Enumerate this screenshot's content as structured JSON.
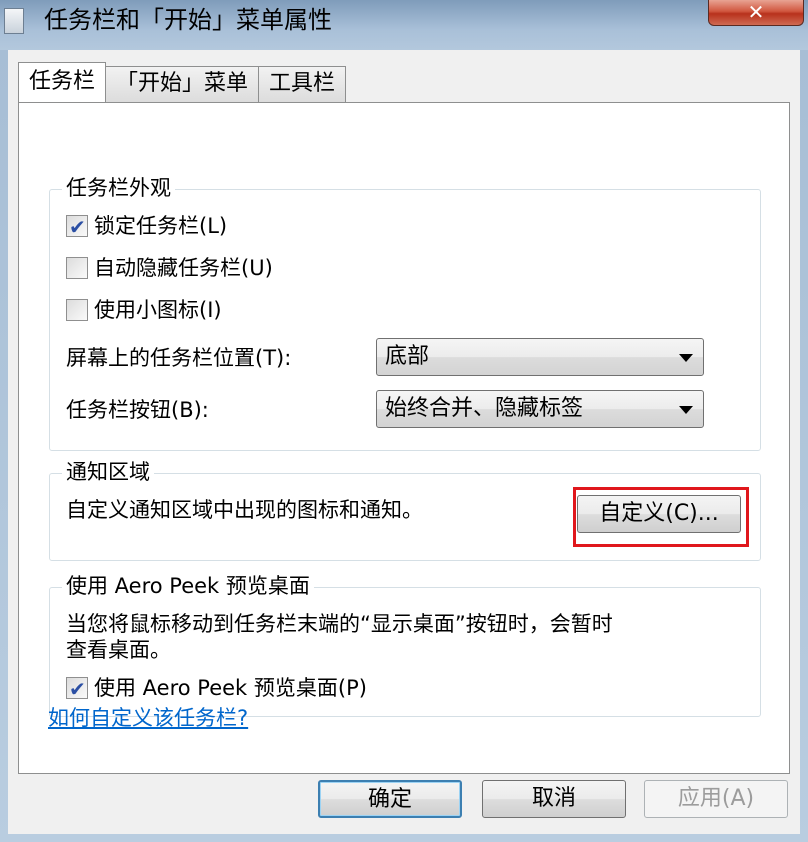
{
  "window": {
    "title": "任务栏和「开始」菜单属性",
    "close_label": "✕"
  },
  "tabs": [
    {
      "label": "任务栏",
      "active": true
    },
    {
      "label": "「开始」菜单",
      "active": false
    },
    {
      "label": "工具栏",
      "active": false
    }
  ],
  "appearance": {
    "title": "任务栏外观",
    "lock_taskbar": {
      "label": "锁定任务栏(L)",
      "checked": true
    },
    "auto_hide": {
      "label": "自动隐藏任务栏(U)",
      "checked": false
    },
    "small_icons": {
      "label": "使用小图标(I)",
      "checked": false
    },
    "location_label": "屏幕上的任务栏位置(T):",
    "location_value": "底部",
    "buttons_label": "任务栏按钮(B):",
    "buttons_value": "始终合并、隐藏标签"
  },
  "notification": {
    "title": "通知区域",
    "description": "自定义通知区域中出现的图标和通知。",
    "customize_label": "自定义(C)..."
  },
  "aero_peek": {
    "title": "使用 Aero Peek 预览桌面",
    "description_line1": "当您将鼠标移动到任务栏末端的“显示桌面”按钮时，会暂时",
    "description_line2": "查看桌面。",
    "use_peek": {
      "label": "使用 Aero Peek 预览桌面(P)",
      "checked": true
    }
  },
  "help_link": "如何自定义该任务栏?",
  "footer": {
    "ok_label": "确定",
    "cancel_label": "取消",
    "apply_label": "应用(A)"
  },
  "colors": {
    "highlight_border": "#e0171c",
    "link": "#0066cc"
  }
}
